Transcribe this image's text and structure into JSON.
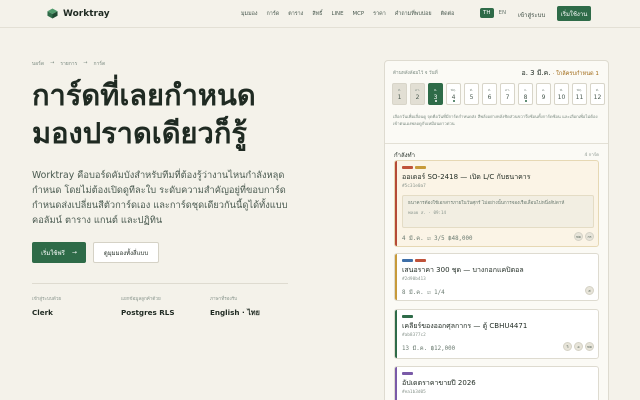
{
  "nav": {
    "brand": "Worktray",
    "links": [
      "มุมมอง",
      "การ์ด",
      "ตาราง",
      "สิทธิ์",
      "LINE",
      "MCP",
      "ราคา",
      "คำถามที่พบบ่อย",
      "ติดต่อ"
    ],
    "lang_th": "TH",
    "lang_en": "EN",
    "signin": "เข้าสู่ระบบ",
    "start": "เริ่มใช้งาน"
  },
  "hero": {
    "breadcrumb": [
      "บอร์ด",
      "รายการ",
      "การ์ด"
    ],
    "title_line1": "การ์ดที่เลยกำหนด",
    "title_line2": "มองปราดเดียวก็รู้",
    "description": "Worktray คือบอร์ดคัมบังสำหรับทีมที่ต้องรู้ว่างานไหนกำลังหลุดกำหนด โดยไม่ต้องเปิดดูทีละใบ ระดับความสำคัญอยู่ที่ขอบการ์ด กำหนดส่งเปลี่ยนสีตัวการ์ดเอง และการ์ดชุดเดียวกันนี้ดูได้ทั้งแบบคอลัมน์ ตาราง แกนต์ และปฏิทิน",
    "cta_primary": "เริ่มใช้ฟรี",
    "cta_arrow": "→",
    "cta_secondary": "ดูมุมมองทั้งสี่แบบ"
  },
  "stats": [
    {
      "label": "เข้าสู่ระบบด้วย",
      "value": "Clerk"
    },
    {
      "label": "แยกข้อมูลลูกค้าด้วย",
      "value": "Postgres RLS"
    },
    {
      "label": "ภาษาที่รองรับ",
      "value": "English · ไทย"
    }
  ],
  "panel": {
    "header_left": "ด้านหลังล้อมไว้   จ   วันที่",
    "header_date": "อ. 3 มี.ค.",
    "header_hint": "· ใกล้ครบกำหนด 1",
    "days": [
      {
        "w": "ส.",
        "n": "1",
        "state": "past",
        "dot": false
      },
      {
        "w": "อา.",
        "n": "2",
        "state": "past",
        "dot": false
      },
      {
        "w": "จ.",
        "n": "3",
        "state": "today",
        "dot": true
      },
      {
        "w": "พฤ.",
        "n": "4",
        "state": "normal",
        "dot": true
      },
      {
        "w": "ศ.",
        "n": "5",
        "state": "normal",
        "dot": false
      },
      {
        "w": "ส.",
        "n": "6",
        "state": "normal",
        "dot": false
      },
      {
        "w": "อา.",
        "n": "7",
        "state": "normal",
        "dot": false
      },
      {
        "w": "จ.",
        "n": "8",
        "state": "normal",
        "dot": true
      },
      {
        "w": "อ.",
        "n": "9",
        "state": "normal",
        "dot": false
      },
      {
        "w": "พ.",
        "n": "10",
        "state": "normal",
        "dot": false
      },
      {
        "w": "พฤ.",
        "n": "11",
        "state": "normal",
        "dot": false
      },
      {
        "w": "ศ.",
        "n": "12",
        "state": "normal",
        "dot": false
      },
      {
        "w": "ส.",
        "n": "13",
        "state": "normal",
        "dot": true
      }
    ],
    "note": "เลือกวันเพื่อเลื่อนดู จุดคือวันที่มีการ์ดกำหนดส่ง สีพลังอย่างหลังชิดส่วนขวาจึงซ้อนทั้งการ์ดซ้อน และเลือกเพื่อไม่ต้องเข้าตนเองพลอดูกับเหมือนดาวด่วน",
    "section_title": "กำลังทำ",
    "section_count": "4 การ์ด",
    "cards": [
      {
        "title": "ออเดอร์ SO-2418 — เปิด L/C กับธนาคาร",
        "id": "#5c31e0a7",
        "comment": "ธนาคารต้องใช้เอกสารภายในวันศุกร์ ไม่อย่างนั้นการจองเรือเลื่อนไปหนึ่งสัปดาห์",
        "comment_meta": "พลอย ส. · 09:14",
        "meta": "4 มี.ค.  ☑ 3/5  ฿48,000",
        "avatars": [
          "พล",
          "กร"
        ],
        "accent": "#b54a37",
        "tags": [
          "#c0523a",
          "#c79a3a"
        ],
        "urgent": true
      },
      {
        "title": "เสนอราคา 300 ชุด — บางกอกแคปิตอล",
        "id": "#2d90b413",
        "meta": "8 มี.ค.  ☑ 1/4",
        "avatars": [
          "ส"
        ],
        "accent": "#c79a3a",
        "tags": [
          "#3e6fa8",
          "#c0523a"
        ],
        "urgent": false
      },
      {
        "title": "เคลียร์ของออกศุลกากร — ตู้ CBHU4471",
        "id": "#ab8377c2",
        "meta": "13 มี.ค.  ฿12,000",
        "avatars": [
          "วิ",
          "อ",
          "พล"
        ],
        "accent": "#2e6b48",
        "tags": [
          "#2e6b48"
        ],
        "urgent": false
      },
      {
        "title": "อัปเดตราคาขายปี 2026",
        "id": "#ea1b3d05",
        "meta": "",
        "avatars": [],
        "accent": "#7a5aa8",
        "tags": [
          "#7a5aa8"
        ],
        "urgent": false
      }
    ]
  }
}
